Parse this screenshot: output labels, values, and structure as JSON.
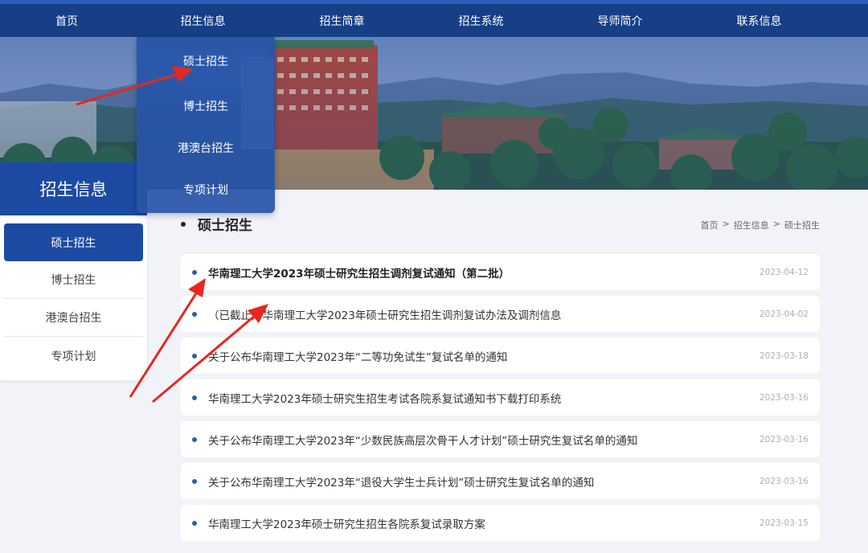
{
  "nav": {
    "items": [
      {
        "label": "首页"
      },
      {
        "label": "招生信息"
      },
      {
        "label": "招生简章"
      },
      {
        "label": "招生系统"
      },
      {
        "label": "导师简介"
      },
      {
        "label": "联系信息"
      }
    ]
  },
  "dropdown": {
    "items": [
      {
        "label": "硕士招生"
      },
      {
        "label": "博士招生"
      },
      {
        "label": "港澳台招生"
      },
      {
        "label": "专项计划"
      }
    ]
  },
  "sidebar": {
    "title": "招生信息",
    "items": [
      {
        "label": "硕士招生",
        "active": true
      },
      {
        "label": "博士招生"
      },
      {
        "label": "港澳台招生"
      },
      {
        "label": "专项计划"
      }
    ]
  },
  "section": {
    "title": "硕士招生"
  },
  "breadcrumb": {
    "items": [
      "首页",
      "招生信息",
      "硕士招生"
    ],
    "separator": ">"
  },
  "news": [
    {
      "title": "华南理工大学2023年硕士研究生招生调剂复试通知（第二批）",
      "date": "2023-04-12",
      "bold": true
    },
    {
      "title": "（已截止）华南理工大学2023年硕士研究生招生调剂复试办法及调剂信息",
      "date": "2023-04-02"
    },
    {
      "title": "关于公布华南理工大学2023年“二等功免试生”复试名单的通知",
      "date": "2023-03-18"
    },
    {
      "title": "华南理工大学2023年硕士研究生招生考试各院系复试通知书下载打印系统",
      "date": "2023-03-16"
    },
    {
      "title": "关于公布华南理工大学2023年“少数民族高层次骨干人才计划”硕士研究生复试名单的通知",
      "date": "2023-03-16"
    },
    {
      "title": "关于公布华南理工大学2023年“退役大学生士兵计划”硕士研究生复试名单的通知",
      "date": "2023-03-16"
    },
    {
      "title": "华南理工大学2023年硕士研究生招生各院系复试录取方案",
      "date": "2023-03-15"
    }
  ],
  "colors": {
    "nav_bg": "#163f86",
    "accent": "#1c4aa3",
    "dropdown_bg": "#2854a8",
    "annotation_arrow": "#e8281e",
    "bullet": "#2b5cae"
  }
}
